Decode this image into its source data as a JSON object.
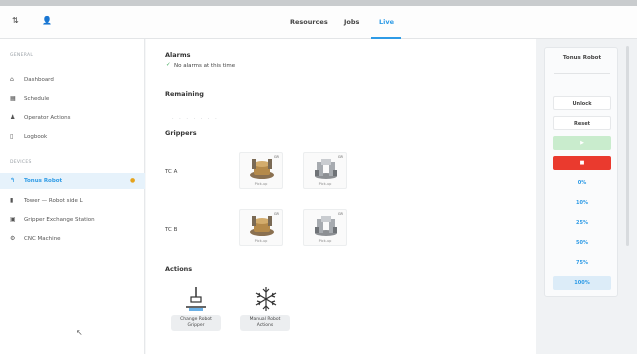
{
  "topbar": {
    "left_icon_1": "swap-icon",
    "left_icon_2": "user-icon",
    "tabs": [
      {
        "label": "Resources",
        "active": false
      },
      {
        "label": "Jobs",
        "active": false
      },
      {
        "label": "Live",
        "active": true
      }
    ]
  },
  "sidebar": {
    "section1": "GENERAL",
    "items1": [
      {
        "label": "Dashboard",
        "icon": "home-icon"
      },
      {
        "label": "Schedule",
        "icon": "calendar-icon"
      },
      {
        "label": "Operator Actions",
        "icon": "person-icon"
      },
      {
        "label": "Logbook",
        "icon": "document-icon"
      }
    ],
    "section2": "DEVICES",
    "items2": [
      {
        "label": "Tonus Robot",
        "icon": "robot-arm-icon",
        "active": true,
        "warning": true
      },
      {
        "label": "Tower — Robot side L",
        "icon": "tower-icon"
      },
      {
        "label": "Gripper Exchange Station",
        "icon": "station-icon"
      },
      {
        "label": "CNC Machine",
        "icon": "gear-icon"
      }
    ]
  },
  "main": {
    "alarms": {
      "title": "Alarms",
      "status": "No alarms at this time"
    },
    "remaining": {
      "title": "Remaining"
    },
    "grippers": {
      "title": "Grippers",
      "rows": [
        {
          "label": "TC A",
          "cards": [
            {
              "tag": "GR",
              "caption": "Pick-up"
            },
            {
              "tag": "GR",
              "caption": "Pick-up"
            }
          ]
        },
        {
          "label": "TC B",
          "cards": [
            {
              "tag": "GR",
              "caption": "Pick-up"
            },
            {
              "tag": "GR",
              "caption": "Pick-up"
            }
          ]
        }
      ]
    },
    "actions": {
      "title": "Actions",
      "items": [
        {
          "label_line1": "Change Robot",
          "label_line2": "Gripper",
          "icon": "gripper-change-icon"
        },
        {
          "label_line1": "Manual Robot",
          "label_line2": "Actions",
          "icon": "snowflake-icon"
        }
      ]
    }
  },
  "right_panel": {
    "title": "Tonus Robot",
    "buttons": [
      {
        "label": "Unlock",
        "style": "plain"
      },
      {
        "label": "Reset",
        "style": "plain"
      },
      {
        "label": "▶",
        "style": "green"
      },
      {
        "label": "■",
        "style": "red"
      },
      {
        "label": "0%",
        "style": "pct"
      },
      {
        "label": "10%",
        "style": "pct"
      },
      {
        "label": "25%",
        "style": "pct"
      },
      {
        "label": "50%",
        "style": "pct"
      },
      {
        "label": "75%",
        "style": "pct"
      },
      {
        "label": "100%",
        "style": "sel"
      }
    ],
    "colors": {
      "accent": "#2e9be6",
      "stop": "#ea3a2e",
      "start": "#c9eccd",
      "warning": "#e5a31c"
    }
  }
}
